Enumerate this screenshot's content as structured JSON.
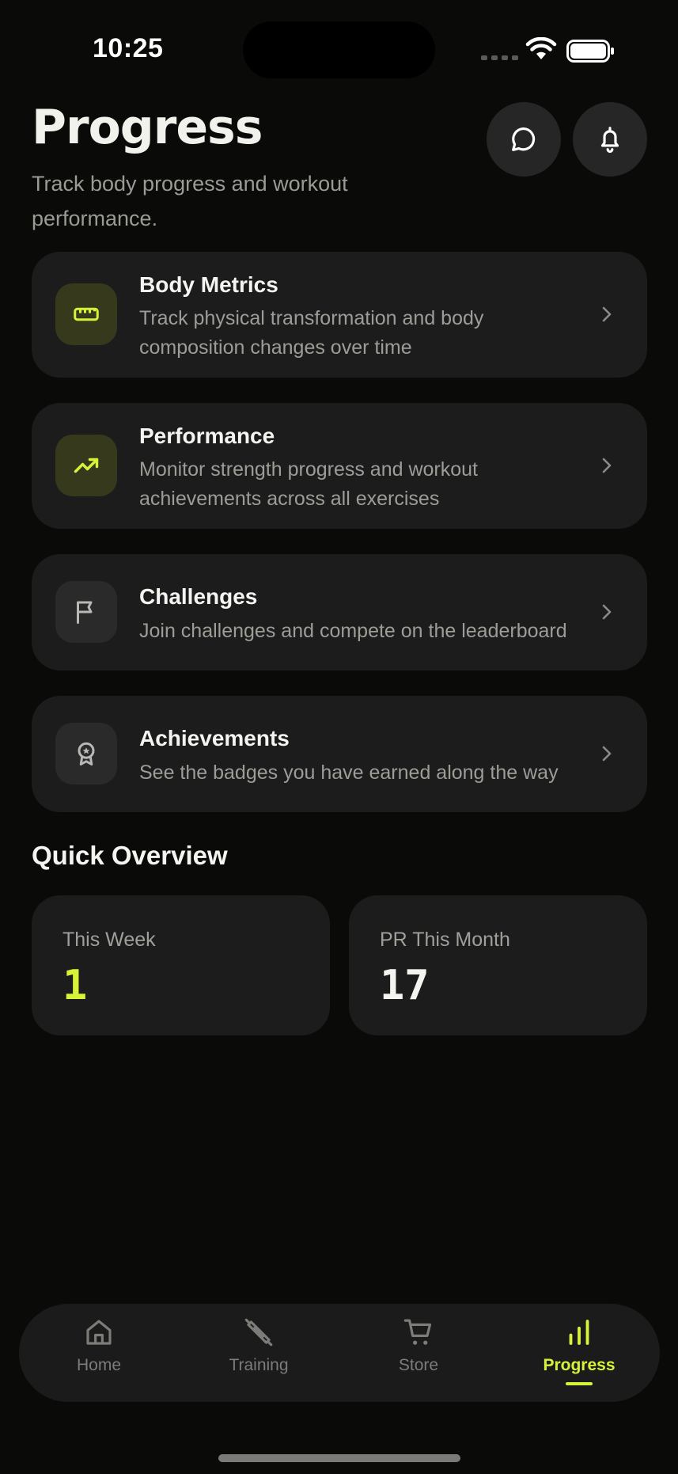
{
  "status_bar": {
    "time": "10:25"
  },
  "header": {
    "title": "Progress",
    "subtitle": "Track body progress and workout performance."
  },
  "header_buttons": {
    "chat_icon": "chat-bubble-icon",
    "bell_icon": "bell-icon"
  },
  "menu": [
    {
      "title": "Body Metrics",
      "description": "Track physical transformation and body composition changes over time",
      "icon": "ruler-icon",
      "highlighted": true
    },
    {
      "title": "Performance",
      "description": "Monitor strength progress and workout achievements across all exercises",
      "icon": "trending-up-icon",
      "highlighted": true
    },
    {
      "title": "Challenges",
      "description": "Join challenges and compete on the leaderboard",
      "icon": "flag-icon",
      "highlighted": false
    },
    {
      "title": "Achievements",
      "description": "See the badges you have earned along the way",
      "icon": "badge-icon",
      "highlighted": false
    }
  ],
  "overview": {
    "title": "Quick Overview",
    "stats": [
      {
        "label": "This Week",
        "value": "1",
        "color": "#d8f23a"
      },
      {
        "label": "PR This Month",
        "value": "17",
        "color": "#f4f4f0"
      }
    ]
  },
  "tabs": [
    {
      "label": "Home",
      "icon": "home-icon",
      "active": false
    },
    {
      "label": "Training",
      "icon": "dumbbell-icon",
      "active": false
    },
    {
      "label": "Store",
      "icon": "cart-icon",
      "active": false
    },
    {
      "label": "Progress",
      "icon": "bar-chart-icon",
      "active": true
    }
  ],
  "colors": {
    "accent": "#d8f23a",
    "background": "#0a0b08",
    "card": "#1c1c1c"
  }
}
